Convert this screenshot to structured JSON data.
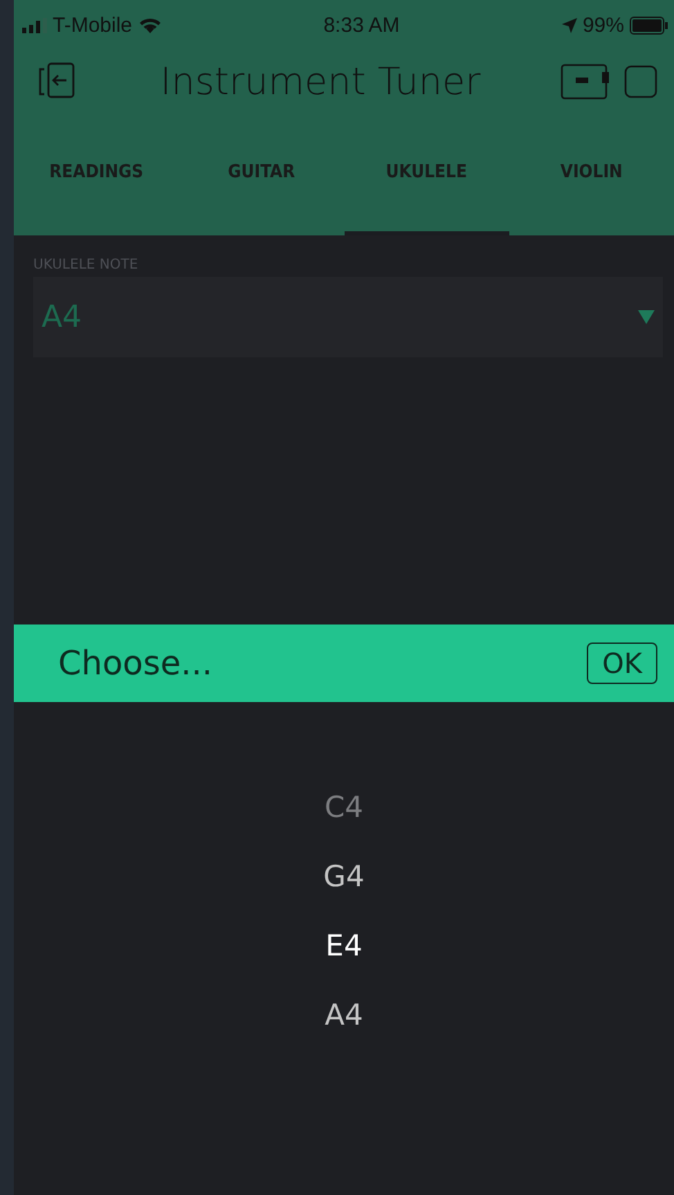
{
  "status_bar": {
    "carrier": "T-Mobile",
    "time": "8:33 AM",
    "battery": "99%"
  },
  "header": {
    "title": "Instrument Tuner"
  },
  "tabs": [
    {
      "label": "READINGS",
      "selected": false
    },
    {
      "label": "GUITAR",
      "selected": false
    },
    {
      "label": "UKULELE",
      "selected": true
    },
    {
      "label": "VIOLIN",
      "selected": false
    }
  ],
  "note_field": {
    "label": "UKULELE NOTE",
    "value": "A4"
  },
  "picker": {
    "title": "Choose...",
    "ok": "OK",
    "options": [
      {
        "label": "C4",
        "selected": false
      },
      {
        "label": "G4",
        "selected": false
      },
      {
        "label": "E4",
        "selected": true
      },
      {
        "label": "A4",
        "selected": false
      }
    ]
  }
}
